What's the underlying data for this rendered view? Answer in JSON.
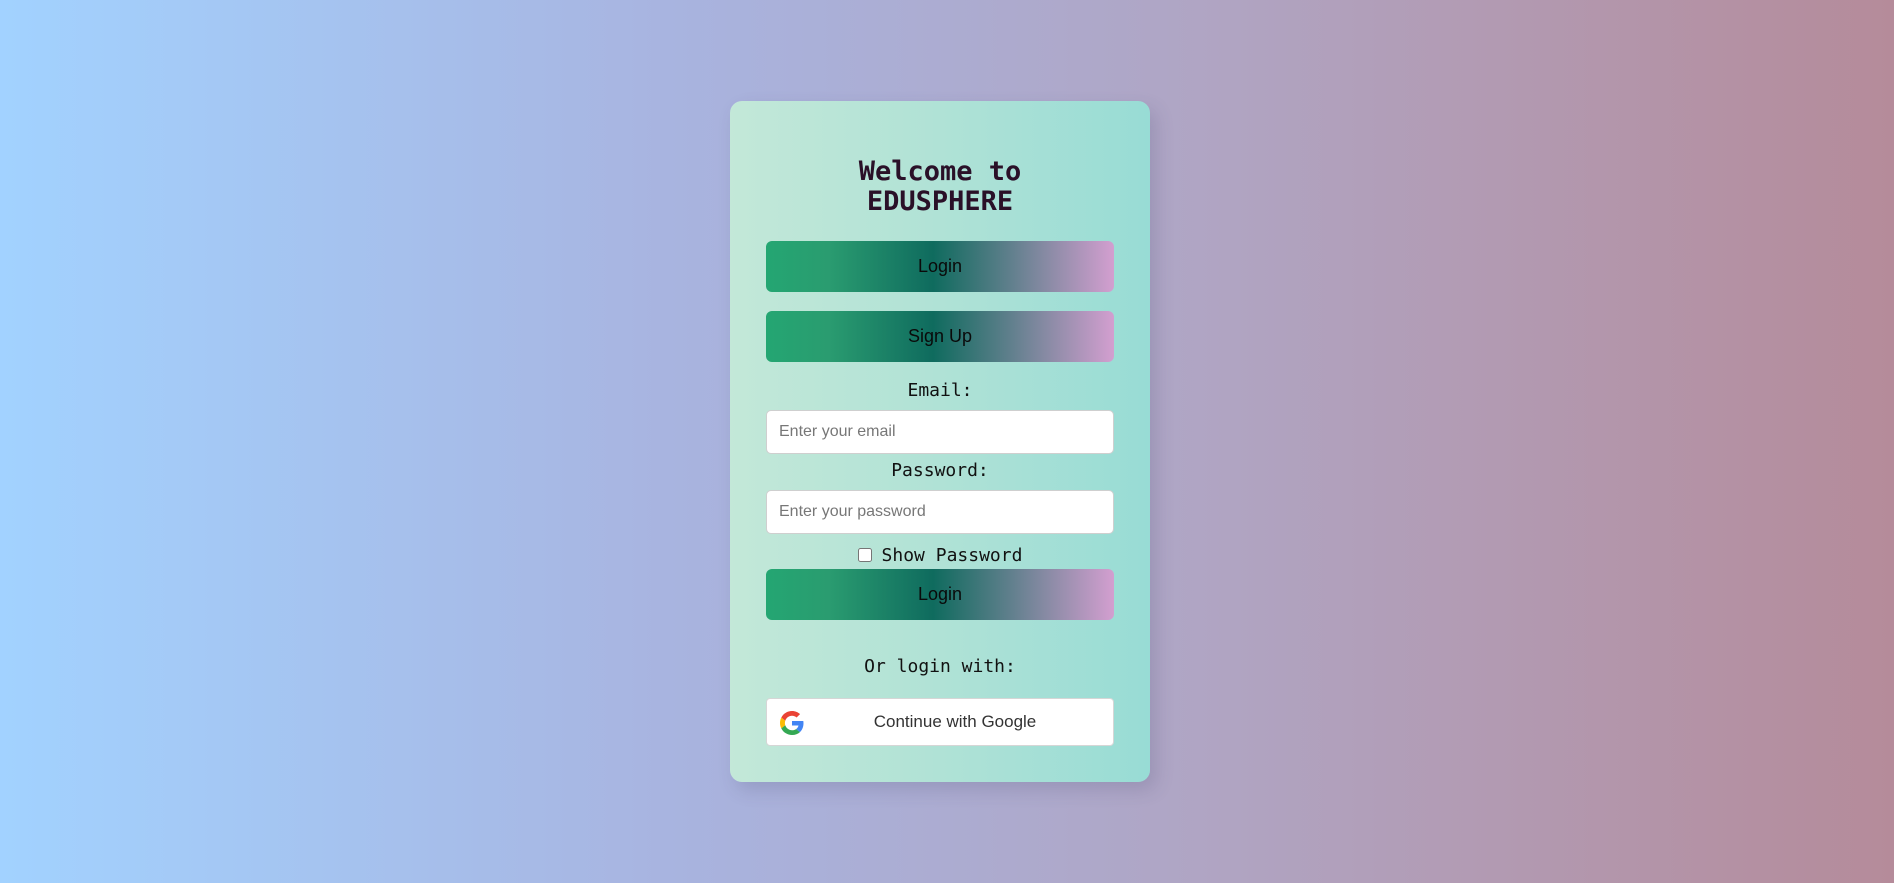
{
  "card": {
    "title_line1": "Welcome to",
    "title_line2": "EDUSPHERE"
  },
  "tabs": {
    "login_label": "Login",
    "signup_label": "Sign Up"
  },
  "form": {
    "email_label": "Email:",
    "email_placeholder": "Enter your email",
    "password_label": "Password:",
    "password_placeholder": "Enter your password",
    "show_password_label": "Show Password",
    "show_password_checked": false,
    "submit_label": "Login"
  },
  "social": {
    "or_text": "Or login with:",
    "google_label": "Continue with Google",
    "google_icon": "google-g-icon"
  },
  "colors": {
    "button_gradient": [
      "#24a672",
      "#0f6b5e",
      "#d39fd0"
    ],
    "card_gradient": [
      "#c3e8d8",
      "#98dcd5"
    ],
    "page_gradient": [
      "#a2d2ff",
      "#b58b9a"
    ]
  }
}
